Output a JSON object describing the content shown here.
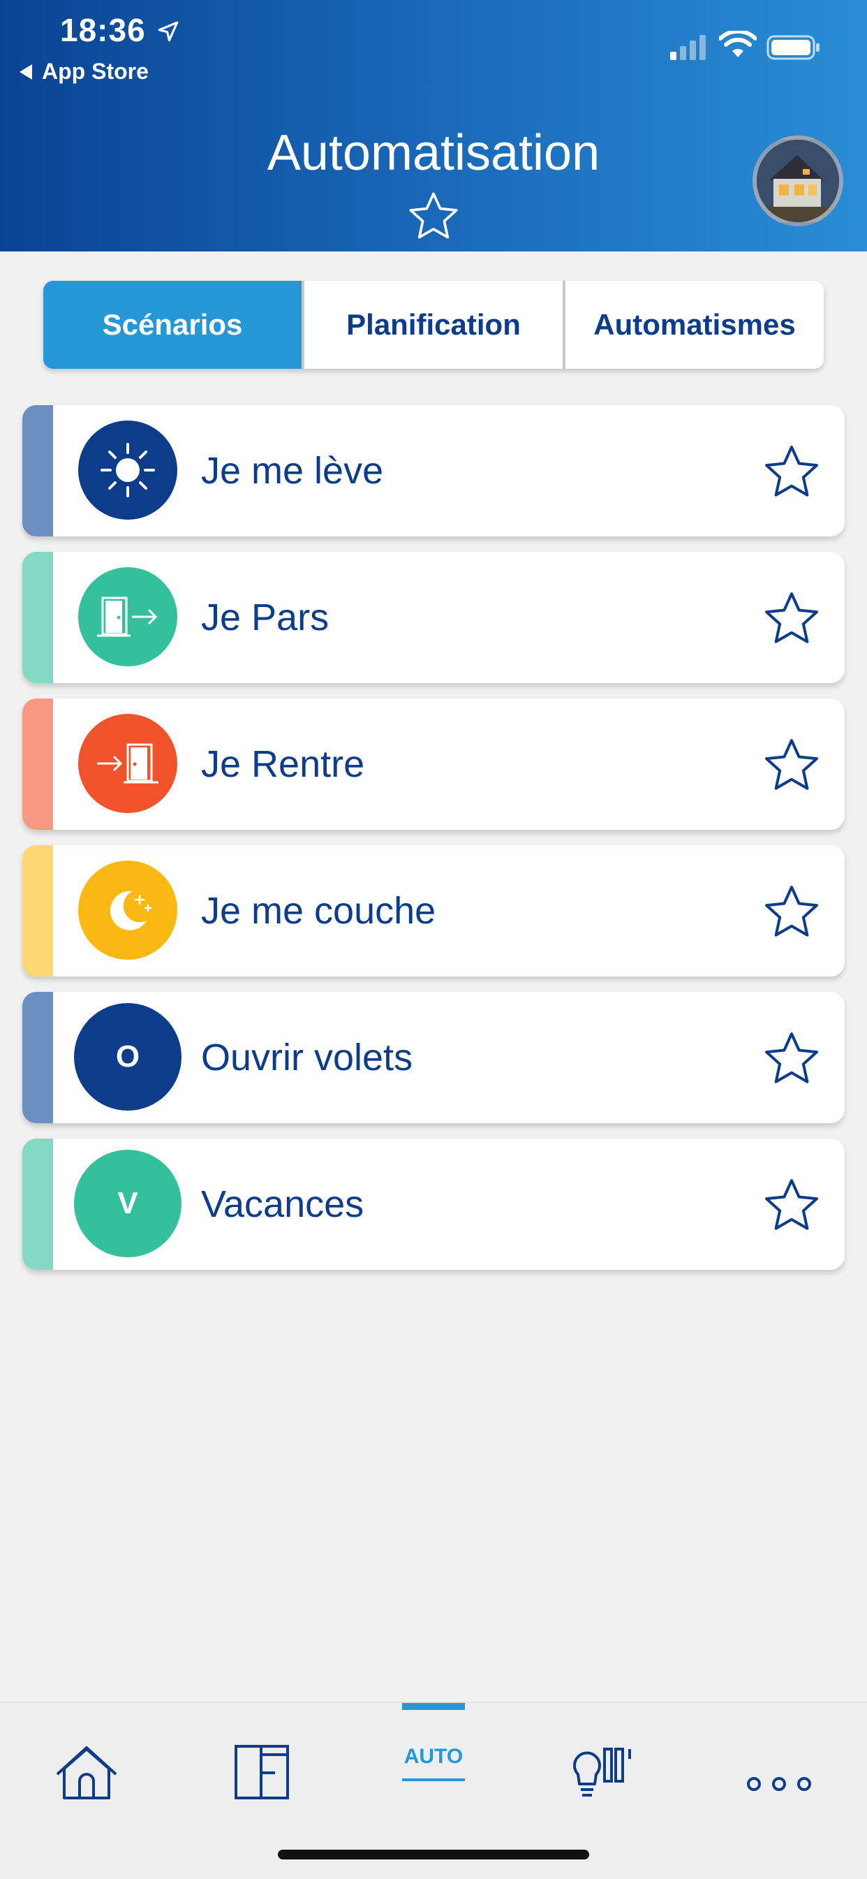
{
  "status_bar": {
    "time": "18:36",
    "back_label": "App Store"
  },
  "header": {
    "title": "Automatisation"
  },
  "tabs": [
    {
      "label": "Scénarios",
      "active": true
    },
    {
      "label": "Planification",
      "active": false
    },
    {
      "label": "Automatismes",
      "active": false
    }
  ],
  "scenarios": [
    {
      "label": "Je me lève",
      "icon": "sun-icon",
      "color": "#0d3d8a",
      "bar_color": "#6b8fc0"
    },
    {
      "label": "Je Pars",
      "icon": "door-exit-icon",
      "color": "#35c09c",
      "bar_color": "#84d9c4"
    },
    {
      "label": "Je Rentre",
      "icon": "door-enter-icon",
      "color": "#f0532a",
      "bar_color": "#f79980"
    },
    {
      "label": "Je me couche",
      "icon": "moon-icon",
      "color": "#fbb813",
      "bar_color": "#fdd872"
    },
    {
      "label": "Ouvrir volets",
      "letter": "O",
      "color": "#0d3d8a",
      "bar_color": "#6b8fc0"
    },
    {
      "label": "Vacances",
      "letter": "V",
      "color": "#35c09c",
      "bar_color": "#84d9c4"
    }
  ],
  "bottom_nav": {
    "items": [
      "home-icon",
      "floorplan-icon",
      "auto",
      "lighting-shutters-icon",
      "more-icon"
    ],
    "auto_label": "AUTO",
    "active": "auto"
  },
  "colors": {
    "header_start": "#0a4394",
    "header_end": "#2a8dd5",
    "accent": "#2596d6",
    "text_primary": "#0d3d8a",
    "background": "#f1f1f1"
  }
}
